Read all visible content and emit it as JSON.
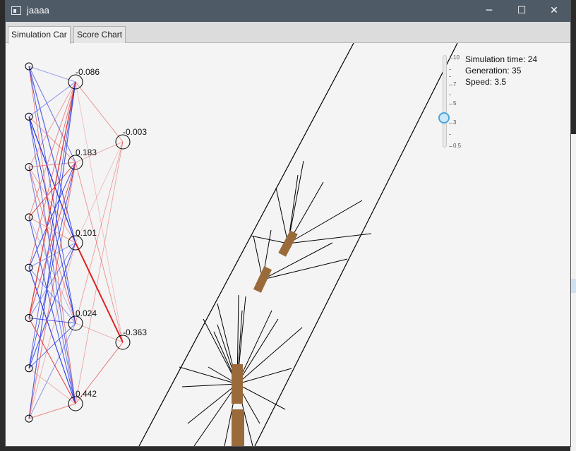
{
  "window": {
    "title": "jaaaa",
    "minimize_icon": "minimize-icon",
    "maximize_icon": "maximize-icon",
    "close_icon": "close-icon"
  },
  "tabs": [
    {
      "label": "Simulation Car",
      "active": true
    },
    {
      "label": "Score Chart",
      "active": false
    }
  ],
  "info": {
    "simulation_time": "Simulation time: 24",
    "generation": "Generation: 35",
    "speed": "Speed: 3.5"
  },
  "speed_slider": {
    "value": 3.5,
    "min": 0.5,
    "max": 10,
    "tick_labels": [
      "10",
      "7",
      "5",
      "3",
      "0.5"
    ]
  },
  "network": {
    "input_count": 8,
    "hidden_values": [
      "-0.086",
      "0.183",
      "0.101",
      "0.024",
      "0.442"
    ],
    "output_values": [
      "-0.003",
      "-0.363"
    ]
  },
  "colors": {
    "titlebar": "#4e5a66",
    "positive_weight": "#e02020",
    "negative_weight": "#2030e0",
    "car": "#9a6a3a",
    "slider_accent": "#49a6d9"
  }
}
